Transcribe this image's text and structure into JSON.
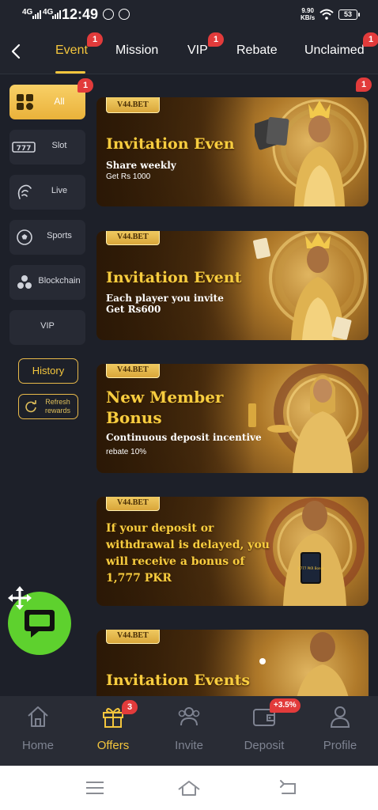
{
  "status_bar": {
    "network1": "4G",
    "network2": "4G",
    "time": "12:49",
    "speed_value": "9.90",
    "speed_unit": "KB/s",
    "battery": "53"
  },
  "tabs": [
    {
      "label": "Event",
      "badge": "1",
      "active": true
    },
    {
      "label": "Mission",
      "badge": "",
      "active": false
    },
    {
      "label": "VIP",
      "badge": "1",
      "active": false
    },
    {
      "label": "Rebate",
      "badge": "",
      "active": false
    },
    {
      "label": "Unclaimed",
      "badge": "1",
      "active": false
    }
  ],
  "sidebar": {
    "items": [
      {
        "label": "All",
        "icon": "grid-icon",
        "badge": "1",
        "active": true
      },
      {
        "label": "Slot",
        "icon": "slot-777-icon"
      },
      {
        "label": "Live",
        "icon": "live-dealer-icon"
      },
      {
        "label": "Sports",
        "icon": "soccer-ball-icon"
      },
      {
        "label": "Blockchain",
        "icon": "blockchain-icon"
      },
      {
        "label": "VIP"
      }
    ],
    "history_label": "History",
    "refresh_label": "Refresh rewards"
  },
  "banners": [
    {
      "brand": "V44.BET",
      "title": "Invitation Even",
      "subtitle": "Share weekly",
      "detail": "Get Rs 1000",
      "badge": "1"
    },
    {
      "brand": "V44.BET",
      "title": "Invitation Event",
      "subtitle": "Each player you invite",
      "subtitle2": "Get Rs600"
    },
    {
      "brand": "V44.BET",
      "title": "New Member",
      "title2": "Bonus",
      "subtitle": "Continuous deposit incentive",
      "detail": "rebate 10%"
    },
    {
      "brand": "V44.BET",
      "title": "If your deposit or",
      "title2": "withdrawal is delayed, you",
      "title3": "will receive a bonus of",
      "title4": "1,777 PKR",
      "card_text": "1,777 PKR Bonus"
    },
    {
      "brand": "V44.BET",
      "title": "Invitation Events"
    }
  ],
  "bottom_nav": [
    {
      "label": "Home",
      "icon": "home-icon"
    },
    {
      "label": "Offers",
      "icon": "gift-icon",
      "badge": "3",
      "active": true
    },
    {
      "label": "Invite",
      "icon": "invite-people-icon"
    },
    {
      "label": "Deposit",
      "icon": "wallet-icon",
      "badge": "+3.5%"
    },
    {
      "label": "Profile",
      "icon": "profile-icon"
    }
  ],
  "colors": {
    "accent": "#f4c63d",
    "background": "#1d2029",
    "badge": "#e23b3b",
    "chat": "#5ed12e"
  }
}
